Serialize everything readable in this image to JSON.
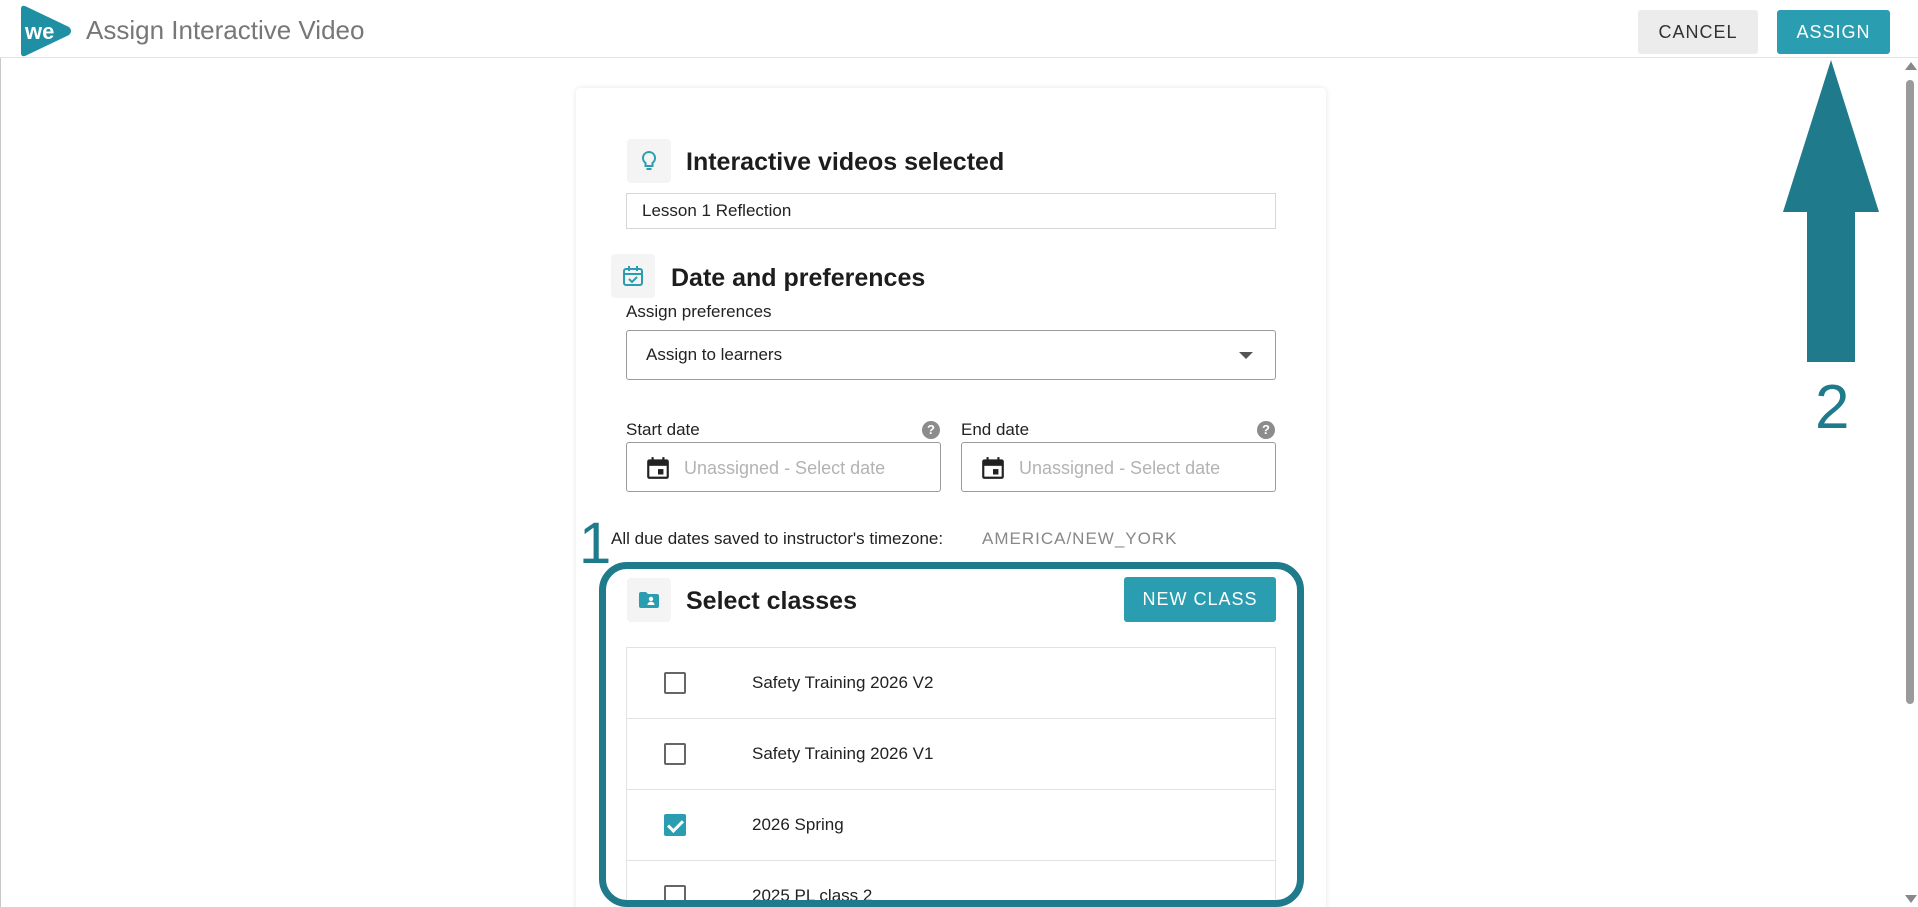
{
  "header": {
    "title": "Assign Interactive Video",
    "cancel_label": "CANCEL",
    "assign_label": "ASSIGN",
    "logo_text": "we"
  },
  "videos": {
    "title": "Interactive videos selected",
    "selected_value": "Lesson 1 Reflection"
  },
  "preferences": {
    "title": "Date and preferences",
    "assign_label": "Assign preferences",
    "assign_value": "Assign to learners",
    "start_label": "Start date",
    "start_placeholder": "Unassigned - Select date",
    "end_label": "End date",
    "end_placeholder": "Unassigned - Select date",
    "help_glyph": "?",
    "timezone_label": "All due dates saved to instructor's timezone:",
    "timezone_value": "AMERICA/NEW_YORK"
  },
  "classes": {
    "title": "Select classes",
    "new_class_label": "NEW CLASS",
    "items": [
      {
        "name": "Safety Training 2026 V2",
        "checked": false
      },
      {
        "name": "Safety Training 2026 V1",
        "checked": false
      },
      {
        "name": "2026 Spring",
        "checked": true
      },
      {
        "name": "2025 PL class 2",
        "checked": false
      }
    ]
  },
  "annotations": {
    "step1": "1",
    "step2": "2"
  },
  "colors": {
    "accent": "#2a9db0",
    "annotation": "#1f7a8c"
  }
}
